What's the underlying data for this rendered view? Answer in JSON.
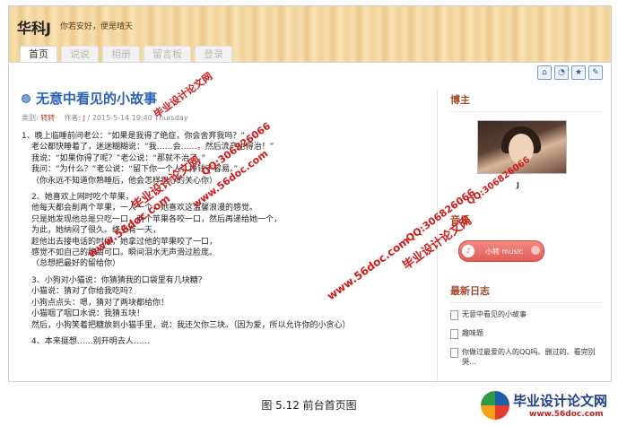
{
  "site": {
    "title": "华科J",
    "slogan": "你若安好，便是晴天"
  },
  "nav": {
    "tabs": [
      "首页",
      "说说",
      "相册",
      "留言板",
      "登录"
    ],
    "active": 0
  },
  "toolbar_icons": [
    "home-icon",
    "rss-icon",
    "star-icon",
    "settings-icon"
  ],
  "post": {
    "title": "无意中看见的小故事",
    "meta": {
      "category_label": "类别:",
      "category": "转转",
      "author_label": "作者:",
      "author": "J",
      "datetime": "2015-5-14 19:40 Thursday"
    },
    "paragraphs": [
      [
        "1、晚上临睡前问老公：“如果是我得了绝症，你会舍弃我吗？”",
        "老公都快睡着了，迷迷糊糊说：“我……会……，然后流产也得治！”",
        "我说：“如果你得了呢？”老公说：“那就不治了。”",
        "我问：“为什么？”老公说：“留下你一个人，挣钱不容易。”",
        "（你永远不知道你熟睡后，他会怎样担心的关心你）"
      ],
      [
        "2、她喜欢上网时吃个苹果，",
        "他每天都会削两个苹果，一人一个，她喜欢这温馨浪漫的感觉。",
        "只是她发现他总是只吃一口，两个苹果各咬一口，然后再递给她一个，",
        "为此，她纳闷了很久。终于有一天，",
        "趁他出去接电话的时候，她拿过他的苹果咬了一口，",
        "感觉不如自己的脆甜可口。瞬间泪水无声滑过脸庞。",
        "（总想把最好的留给你）"
      ],
      [
        "3、小狗对小猫说：你猜猜我的口袋里有几块糖？",
        "小猫说：猜对了你给我吃吗？",
        "小狗点点头：嗯，猜对了两块都给你！",
        "小猫咽了咽口水说：我猜五块！",
        "然后，小狗笑着把糖放到小猫手里，说：我还欠你三块。（因为爱，所以允许你的小贪心）"
      ],
      [
        "4、本来挺想……别开明去人……"
      ]
    ]
  },
  "sidebar": {
    "blogger_heading": "博主",
    "owner_name": "J",
    "music_heading": "音乐",
    "music_label": "小转 music",
    "recent_heading": "最新日志",
    "recent_posts": [
      "无意中看见的小故事",
      "趣味题",
      "你做过最爱的人的QQ吗、删过的、看完别哭…"
    ]
  },
  "watermarks": [
    "www.56doc.com",
    "QQ:306826066",
    "毕业设计论文网",
    "www.56doc.com",
    "QQ:306826066",
    "毕业设计论文网",
    "www.56doc.com",
    "QQ:306826066",
    "毕业设计论文网"
  ],
  "caption": "图 5.12 前台首页图",
  "logo": {
    "text": "毕业设计论文网",
    "url": "www.56doc.com"
  }
}
